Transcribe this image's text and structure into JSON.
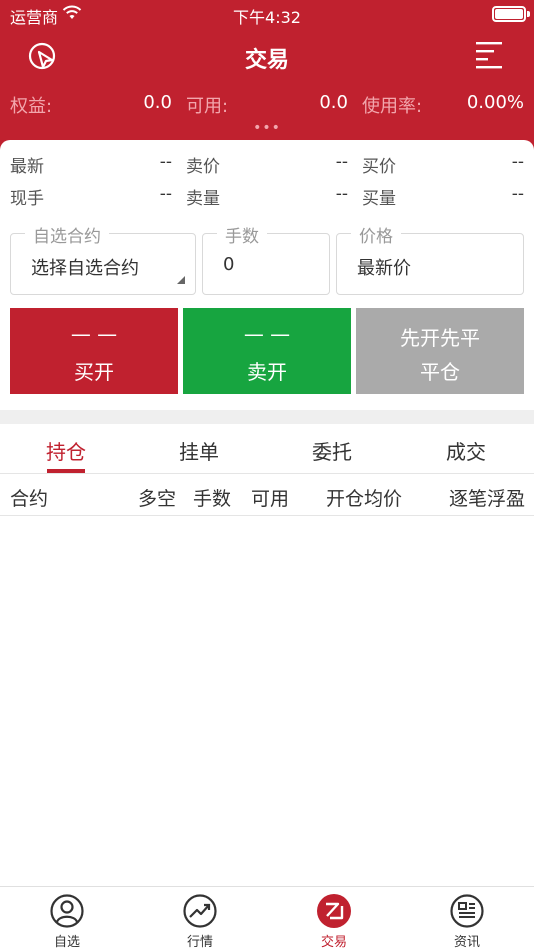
{
  "status_bar": {
    "carrier": "运营商",
    "time": "下午4:32"
  },
  "nav": {
    "title": "交易"
  },
  "account": {
    "equity_label": "权益:",
    "equity_value": "0.0",
    "available_label": "可用:",
    "available_value": "0.0",
    "usage_label": "使用率:",
    "usage_value": "0.00%"
  },
  "handle_dots": "•••",
  "quote": {
    "latest_label": "最新",
    "latest_value": "--",
    "ask_label": "卖价",
    "ask_value": "--",
    "bid_label": "买价",
    "bid_value": "--",
    "volume_label": "现手",
    "volume_value": "--",
    "ask_qty_label": "卖量",
    "ask_qty_value": "--",
    "bid_qty_label": "买量",
    "bid_qty_value": "--"
  },
  "order_form": {
    "contract_legend": "自选合约",
    "contract_value": "选择自选合约",
    "lots_legend": "手数",
    "lots_value": "0",
    "price_legend": "价格",
    "price_value": "最新价"
  },
  "actions": {
    "buy_open_price": "— —",
    "buy_open_label": "买开",
    "sell_open_price": "— —",
    "sell_open_label": "卖开",
    "close_mode_label": "先开先平",
    "close_label": "平仓"
  },
  "colors": {
    "brand_red": "#c0212f",
    "buy_red": "#c0212f",
    "sell_green": "#17a540",
    "close_gray": "#aaaaaa"
  },
  "tabs": {
    "positions": "持仓",
    "pending": "挂单",
    "orders": "委托",
    "trades": "成交"
  },
  "positions_table": {
    "columns": [
      "合约",
      "多空",
      "手数",
      "可用",
      "开仓均价",
      "逐笔浮盈"
    ]
  },
  "tabbar": {
    "watchlist": "自选",
    "market": "行情",
    "trade": "交易",
    "news": "资讯"
  }
}
